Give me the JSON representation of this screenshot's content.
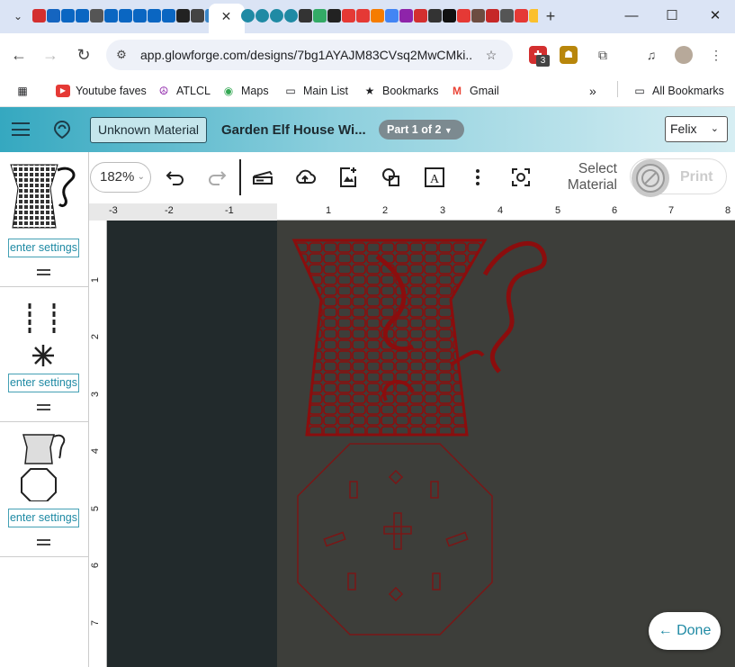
{
  "browser": {
    "url": "app.glowforge.com/designs/7bg1AYAJM83CVsq2MwCMki...",
    "tab_close": "✕",
    "new_tab": "+",
    "minimize": "—",
    "maximize": "☐",
    "close": "✕",
    "tab_dropdown": "⌄",
    "badge_count": "3",
    "bookmarks": [
      "Youtube faves",
      "ATLCL",
      "Maps",
      "Main List",
      "Bookmarks",
      "Gmail"
    ],
    "more_bookmarks": "»",
    "all_bookmarks": "All Bookmarks"
  },
  "app": {
    "material_button": "Unknown Material",
    "design_title": "Garden Elf House Wi...",
    "part_label": "Part 1 of 2",
    "user": "Felix",
    "zoom": "182%",
    "select_material_1": "Select",
    "select_material_2": "Material",
    "print": "Print",
    "done": "← Done"
  },
  "thumbnails": [
    {
      "enter_label": "enter settings"
    },
    {
      "enter_label": "enter settings"
    },
    {
      "enter_label": "enter settings"
    }
  ],
  "rulers": {
    "top": [
      "-3",
      "-2",
      "-1",
      "1",
      "2",
      "3",
      "4",
      "5",
      "6",
      "7",
      "8"
    ],
    "left": [
      "1",
      "2",
      "3",
      "4",
      "5",
      "6",
      "7"
    ]
  },
  "colors": {
    "header_start": "#35a8c0",
    "accent": "#1f8aa4",
    "engrave": "#8b0d0d"
  }
}
